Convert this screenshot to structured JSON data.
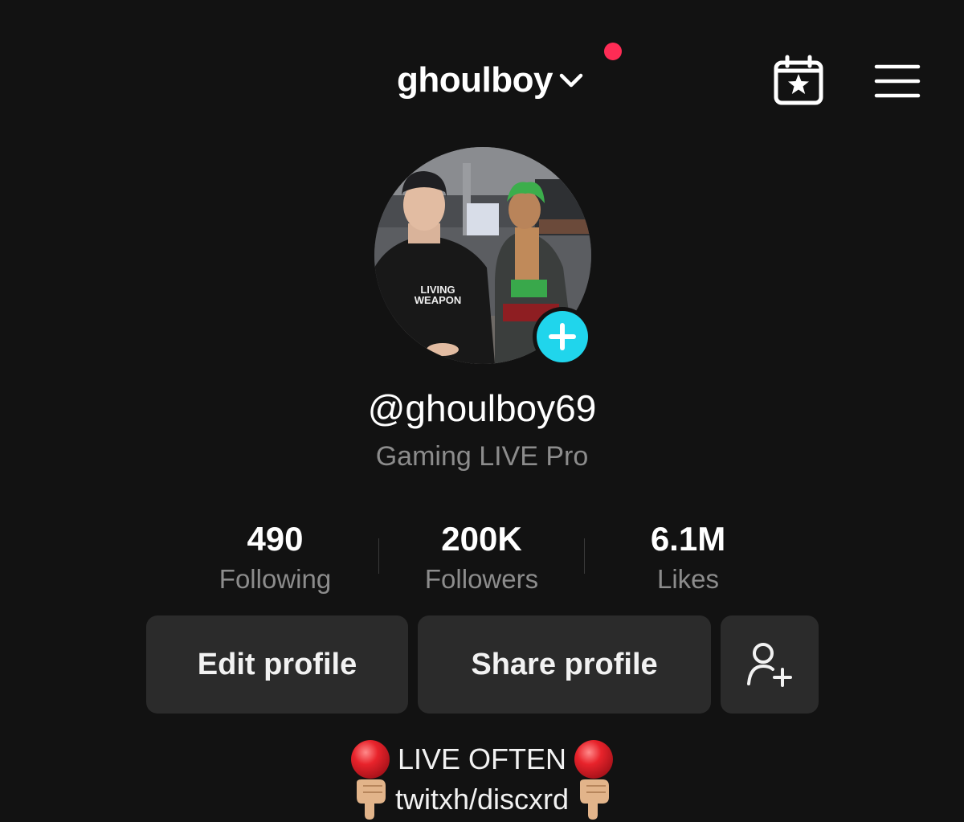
{
  "header": {
    "account_name": "ghoulboy",
    "chevron_icon": "chevron-down-icon",
    "calendar_icon": "calendar-star-icon",
    "menu_icon": "menu-icon"
  },
  "profile": {
    "username": "@ghoulboy69",
    "subtitle": "Gaming LIVE Pro",
    "avatar_add_icon": "plus-icon"
  },
  "stats": [
    {
      "value": "490",
      "label": "Following"
    },
    {
      "value": "200K",
      "label": "Followers"
    },
    {
      "value": "6.1M",
      "label": "Likes"
    }
  ],
  "actions": {
    "edit_label": "Edit profile",
    "share_label": "Share profile",
    "add_friend_icon": "add-user-icon"
  },
  "bio": {
    "line1": "LIVE OFTEN",
    "line1_emoji": "red-circle",
    "line2": "twitxh/discxrd",
    "line2_emoji": "pointing-down-hand"
  },
  "colors": {
    "background": "#121212",
    "accent_dot": "#fe2c55",
    "add_badge": "#20d5ec",
    "button_bg": "#2b2b2b",
    "muted_text": "#8c8c8c"
  }
}
